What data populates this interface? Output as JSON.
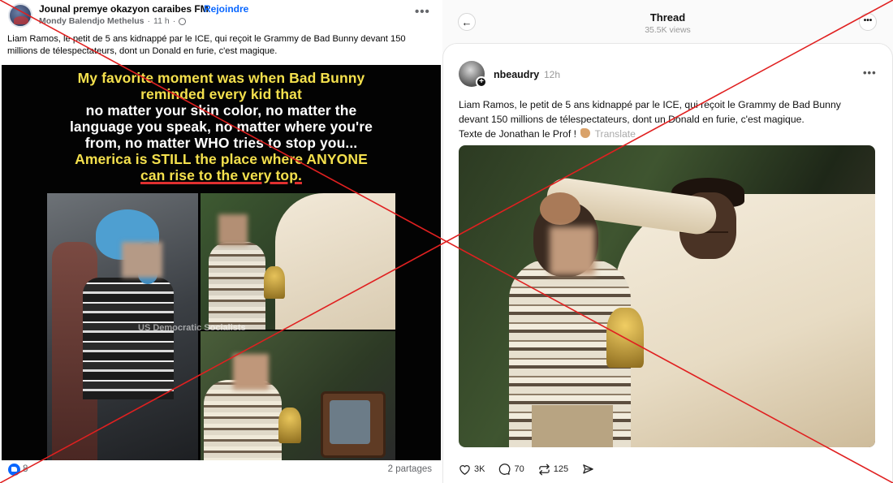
{
  "facebook": {
    "page_name": "Jounal premye okazyon caraibes FM",
    "separator": "·",
    "join_label": "Rejoindre",
    "author": "Mondy Balendjo Methelus",
    "time": "11 h",
    "caption": "Liam Ramos, le petit de 5 ans kidnappé par le ICE, qui reçoit le Grammy de Bad Bunny devant 150 millions de télespectateurs, dont un Donald en furie, c'est magique.",
    "meme": {
      "line1": "My favorite moment was when Bad Bunny",
      "line2": "reminded every kid that",
      "line3": "no matter your skin color, no matter the",
      "line4": "language you speak, no matter where you're",
      "line5": "from, no matter WHO tries to stop you...",
      "line6": "America is STILL the place where ANYONE",
      "line7": "can rise to the very top."
    },
    "watermark": "US Democratic Socialists",
    "reactions_count": "8",
    "shares": "2 partages",
    "more_label": "•••"
  },
  "threads": {
    "title": "Thread",
    "views": "35.5K views",
    "back_label": "←",
    "more_label": "•••",
    "username": "nbeaudry",
    "time": "12h",
    "text_line1": "Liam Ramos, le petit de 5 ans kidnappé par le ICE, qui reçoit le Grammy de Bad Bunny",
    "text_line2": "devant 150 millions de télespectateurs, dont un Donald en furie, c'est magique.",
    "text_line3": "Texte de Jonathan le Prof !",
    "translate_label": "Translate",
    "likes": "3K",
    "comments": "70",
    "reposts": "125"
  },
  "icons": {
    "back": "arrow-left-icon",
    "more": "ellipsis-icon",
    "like": "heart-icon",
    "comment": "speech-bubble-icon",
    "repost": "repost-icon",
    "share": "send-icon",
    "flexed_biceps": "flexed-biceps-emoji",
    "globe": "globe-icon",
    "thumbs_up": "thumbs-up-icon"
  },
  "colors": {
    "facebook_blue": "#0866ff",
    "meme_yellow": "#f4e04d",
    "cross_red": "#e02020"
  }
}
